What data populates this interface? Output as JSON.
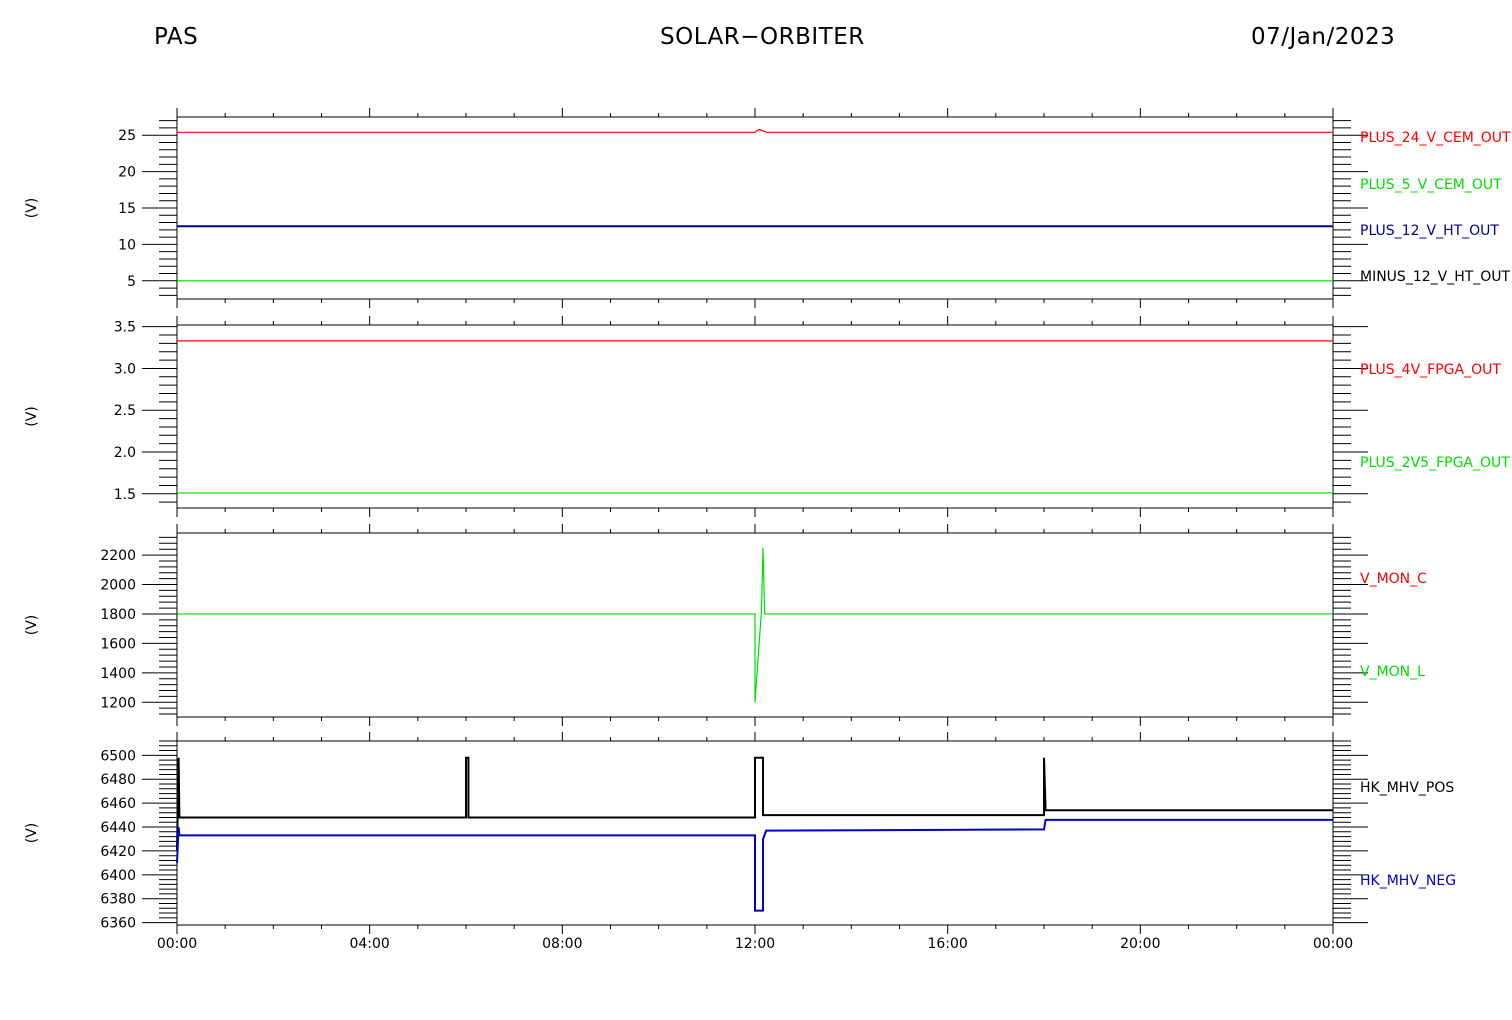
{
  "header": {
    "left": "PAS",
    "center": "SOLAR−ORBITER",
    "right": "07/Jan/2023"
  },
  "chart_data": [
    {
      "type": "line",
      "ylabel": "(V)",
      "ylim": [
        2.5,
        27.5
      ],
      "yticks": [
        5,
        10,
        15,
        20,
        25
      ],
      "x_ticks": [
        "00:00",
        "04:00",
        "08:00",
        "12:00",
        "16:00",
        "20:00",
        "00:00"
      ],
      "series": [
        {
          "name": "PLUS_24_V_CEM_OUT",
          "color": "#ff0000",
          "x": [
            "00:00",
            "12:00",
            "12:05",
            "12:15",
            "24:00"
          ],
          "values": [
            25.4,
            25.4,
            25.8,
            25.4,
            25.4
          ]
        },
        {
          "name": "PLUS_5_V_CEM_OUT",
          "color": "#00dd00",
          "x": [
            "00:00",
            "24:00"
          ],
          "values": [
            5.0,
            5.0
          ]
        },
        {
          "name": "PLUS_12_V_HT_OUT",
          "color": "#00008b",
          "x": [
            "00:00",
            "24:00"
          ],
          "values": [
            12.5,
            12.5
          ]
        },
        {
          "name": "MINUS_12_V_HT_OUT",
          "color": "#000000",
          "x": [],
          "values": []
        }
      ]
    },
    {
      "type": "line",
      "ylabel": "(V)",
      "ylim": [
        1.33,
        3.52
      ],
      "yticks": [
        1.5,
        2.0,
        2.5,
        3.0,
        3.5
      ],
      "ytick_labels": [
        "1.5",
        "2.0",
        "2.5",
        "3.0",
        "3.5"
      ],
      "x_ticks": [
        "00:00",
        "04:00",
        "08:00",
        "12:00",
        "16:00",
        "20:00",
        "00:00"
      ],
      "series": [
        {
          "name": "PLUS_4V_FPGA_OUT",
          "color": "#ff0000",
          "x": [
            "00:00",
            "24:00"
          ],
          "values": [
            3.33,
            3.33
          ]
        },
        {
          "name": "PLUS_2V5_FPGA_OUT",
          "color": "#00dd00",
          "x": [
            "00:00",
            "24:00"
          ],
          "values": [
            1.51,
            1.51
          ]
        }
      ]
    },
    {
      "type": "line",
      "ylabel": "(V)",
      "ylim": [
        1100,
        2350
      ],
      "yticks": [
        1200,
        1400,
        1600,
        1800,
        2000,
        2200
      ],
      "x_ticks": [
        "00:00",
        "04:00",
        "08:00",
        "12:00",
        "16:00",
        "20:00",
        "00:00"
      ],
      "series": [
        {
          "name": "V_MON_C",
          "color": "#ff0000",
          "x": [],
          "values": []
        },
        {
          "name": "V_MON_L",
          "color": "#00dd00",
          "x": [
            "00:00",
            "12:00",
            "12:00",
            "12:08",
            "12:10",
            "12:12",
            "12:14",
            "24:00"
          ],
          "values": [
            1800,
            1800,
            1200,
            1820,
            2250,
            1800,
            1800,
            1800
          ]
        }
      ]
    },
    {
      "type": "line",
      "ylabel": "(V)",
      "ylim": [
        6358,
        6512
      ],
      "yticks": [
        6360,
        6380,
        6400,
        6420,
        6440,
        6460,
        6480,
        6500
      ],
      "x_ticks": [
        "00:00",
        "04:00",
        "08:00",
        "12:00",
        "16:00",
        "20:00",
        "00:00"
      ],
      "series": [
        {
          "name": "HK_MHV_POS",
          "color": "#000000",
          "x": [
            "00:00",
            "00:02",
            "00:03",
            "06:00",
            "06:00",
            "06:03",
            "06:03",
            "12:00",
            "12:00",
            "12:10",
            "12:10",
            "12:14",
            "18:00",
            "18:00",
            "18:02",
            "24:00"
          ],
          "values": [
            6420,
            6498,
            6448,
            6448,
            6498,
            6498,
            6448,
            6448,
            6498,
            6498,
            6450,
            6450,
            6450,
            6498,
            6454,
            6454
          ]
        },
        {
          "name": "HK_MHV_NEG",
          "color": "#0000cc",
          "x": [
            "00:00",
            "00:02",
            "00:03",
            "12:00",
            "12:00",
            "12:10",
            "12:10",
            "12:14",
            "18:00",
            "18:02",
            "24:00"
          ],
          "values": [
            6410,
            6440,
            6433,
            6433,
            6370,
            6370,
            6430,
            6437,
            6438,
            6446,
            6446
          ]
        }
      ]
    }
  ]
}
